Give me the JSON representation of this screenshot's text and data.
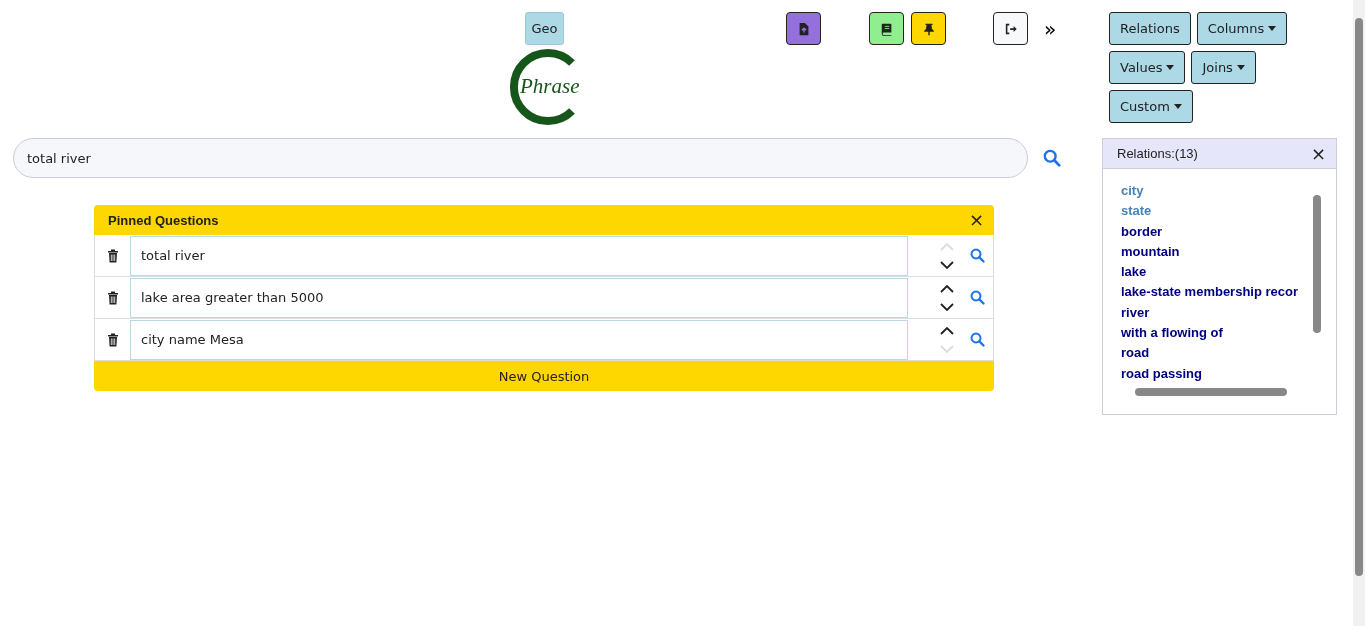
{
  "top_bar": {
    "dataset_button": "Geo",
    "icon_buttons": [
      {
        "kind": "upload",
        "color": "#9370db"
      },
      {
        "kind": "book",
        "color": "#90ee90"
      },
      {
        "kind": "pin",
        "color": "#ffd700"
      },
      {
        "kind": "logout",
        "color": "#f8f9fa"
      }
    ],
    "expand": "»"
  },
  "logo": {
    "text": "Phrase"
  },
  "search": {
    "value": "total river"
  },
  "pinned": {
    "title": "Pinned Questions",
    "close": "×",
    "new_button": "New Question",
    "questions": [
      {
        "text": "total river",
        "up_disabled": true,
        "down_disabled": false
      },
      {
        "text": "lake area greater than 5000",
        "up_disabled": false,
        "down_disabled": false
      },
      {
        "text": "city name Mesa",
        "up_disabled": false,
        "down_disabled": true
      }
    ]
  },
  "toolbar": {
    "buttons": [
      {
        "label": "Relations",
        "dropdown": false
      },
      {
        "label": "Columns",
        "dropdown": true
      },
      {
        "label": "Values",
        "dropdown": true
      },
      {
        "label": "Joins",
        "dropdown": true
      },
      {
        "label": "Custom",
        "dropdown": true
      }
    ]
  },
  "relations_panel": {
    "title": "Relations:(13)",
    "close": "×",
    "items": [
      {
        "label": "city",
        "highlighted": true
      },
      {
        "label": "state",
        "highlighted": true
      },
      {
        "label": "border",
        "highlighted": false
      },
      {
        "label": "mountain",
        "highlighted": false
      },
      {
        "label": "lake",
        "highlighted": false
      },
      {
        "label": "lake-state membership recor",
        "highlighted": false
      },
      {
        "label": "river",
        "highlighted": false
      },
      {
        "label": "with a flowing of",
        "highlighted": false
      },
      {
        "label": "road",
        "highlighted": false
      },
      {
        "label": "road passing",
        "highlighted": false
      }
    ]
  }
}
